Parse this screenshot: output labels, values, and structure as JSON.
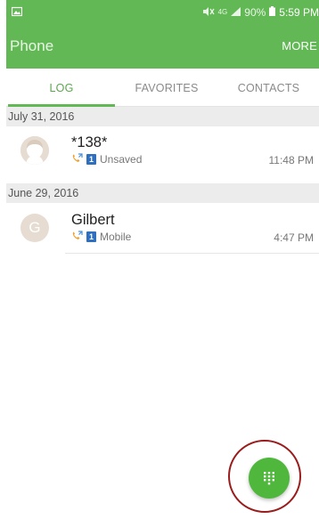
{
  "status_bar": {
    "network_text": "4G",
    "battery": "90%",
    "time": "5:59 PM"
  },
  "header": {
    "title": "Phone",
    "more_label": "MORE"
  },
  "tabs": [
    {
      "label": "LOG",
      "active": true
    },
    {
      "label": "FAVORITES",
      "active": false
    },
    {
      "label": "CONTACTS",
      "active": false
    }
  ],
  "log": {
    "sections": [
      {
        "date": "July 31, 2016",
        "entries": [
          {
            "name": "*138*",
            "label": "Unsaved",
            "sim": "1",
            "time": "11:48 PM",
            "avatar": "default-person"
          }
        ]
      },
      {
        "date": "June 29, 2016",
        "entries": [
          {
            "name": "Gilbert",
            "label": "Mobile",
            "sim": "1",
            "time": "4:47 PM",
            "avatar_letter": "G"
          }
        ]
      }
    ]
  },
  "colors": {
    "accent": "#63b856",
    "fab": "#4fb83c",
    "missed_call": "#f0a030",
    "sim_badge": "#2f6fbe",
    "highlight": "#9a1c1c"
  },
  "icons": {
    "fab": "dialpad-icon",
    "call_type": "outgoing-call-icon",
    "notification": "gallery-icon"
  }
}
